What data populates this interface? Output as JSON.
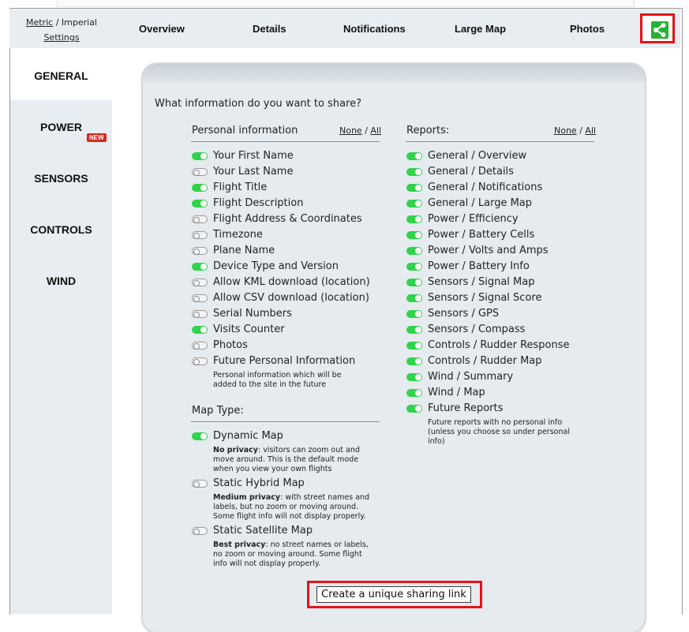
{
  "units": {
    "metric": "Metric",
    "sep": "/",
    "imperial": "Imperial",
    "settings": "Settings"
  },
  "nav": [
    "Overview",
    "Details",
    "Notifications",
    "Large Map",
    "Photos"
  ],
  "share_icon": "share-icon",
  "sidebar": {
    "items": [
      "GENERAL",
      "POWER",
      "SENSORS",
      "CONTROLS",
      "WIND"
    ],
    "active": "GENERAL",
    "new_badge": "NEW"
  },
  "question": "What information do you want to share?",
  "personal": {
    "header": "Personal information",
    "none": "None",
    "slash": "/",
    "all": "All",
    "items": [
      {
        "label": "Your First Name",
        "on": true
      },
      {
        "label": "Your Last Name",
        "on": false
      },
      {
        "label": "Flight Title",
        "on": true
      },
      {
        "label": "Flight Description",
        "on": true
      },
      {
        "label": "Flight Address & Coordinates",
        "on": false
      },
      {
        "label": "Timezone",
        "on": false
      },
      {
        "label": "Plane Name",
        "on": false
      },
      {
        "label": "Device Type and Version",
        "on": true
      },
      {
        "label": "Allow KML download (location)",
        "on": false
      },
      {
        "label": "Allow CSV download (location)",
        "on": false
      },
      {
        "label": "Serial Numbers",
        "on": false
      },
      {
        "label": "Visits Counter",
        "on": true
      },
      {
        "label": "Photos",
        "on": false
      },
      {
        "label": "Future Personal Information",
        "on": false
      }
    ],
    "future_note_1": "Personal information which will be",
    "future_note_2": "added to the site in the future"
  },
  "map_type": {
    "header": "Map Type:",
    "options": [
      {
        "label": "Dynamic Map",
        "on": true,
        "bold": "No privacy",
        "lines": [
          ": visitors can zoom out and",
          "move around. This is the default mode",
          "when you view your own flights"
        ]
      },
      {
        "label": "Static Hybrid Map",
        "on": false,
        "bold": "Medium privacy",
        "lines": [
          ": with street names and",
          "labels, but no zoom or moving around.",
          "Some flight info will not display properly."
        ]
      },
      {
        "label": "Static Satellite Map",
        "on": false,
        "bold": "Best privacy",
        "lines": [
          ": no street names or labels,",
          "no zoom or moving around. Some flight",
          "info will not display properly."
        ]
      }
    ]
  },
  "reports": {
    "header": "Reports:",
    "none": "None",
    "slash": "/",
    "all": "All",
    "items": [
      {
        "label": "General / Overview",
        "on": true
      },
      {
        "label": "General / Details",
        "on": true
      },
      {
        "label": "General / Notifications",
        "on": true
      },
      {
        "label": "General / Large Map",
        "on": true
      },
      {
        "label": "Power / Efficiency",
        "on": true
      },
      {
        "label": "Power / Battery Cells",
        "on": true
      },
      {
        "label": "Power / Volts and Amps",
        "on": true
      },
      {
        "label": "Power / Battery Info",
        "on": true
      },
      {
        "label": "Sensors / Signal Map",
        "on": true
      },
      {
        "label": "Sensors / Signal Score",
        "on": true
      },
      {
        "label": "Sensors / GPS",
        "on": true
      },
      {
        "label": "Sensors / Compass",
        "on": true
      },
      {
        "label": "Controls / Rudder Response",
        "on": true
      },
      {
        "label": "Controls / Rudder Map",
        "on": true
      },
      {
        "label": "Wind / Summary",
        "on": true
      },
      {
        "label": "Wind / Map",
        "on": true
      },
      {
        "label": "Future Reports",
        "on": true
      }
    ],
    "future_note_1": "Future reports with no personal info",
    "future_note_2": "(unless you choose so under personal",
    "future_note_3": "info)"
  },
  "cta": "Create a unique sharing link",
  "colors": {
    "toggle_on": "#2fd44a",
    "share": "#27b236",
    "highlight": "#e0141c",
    "panel": "#e6ebef",
    "nav_bg": "#e8edf1"
  }
}
